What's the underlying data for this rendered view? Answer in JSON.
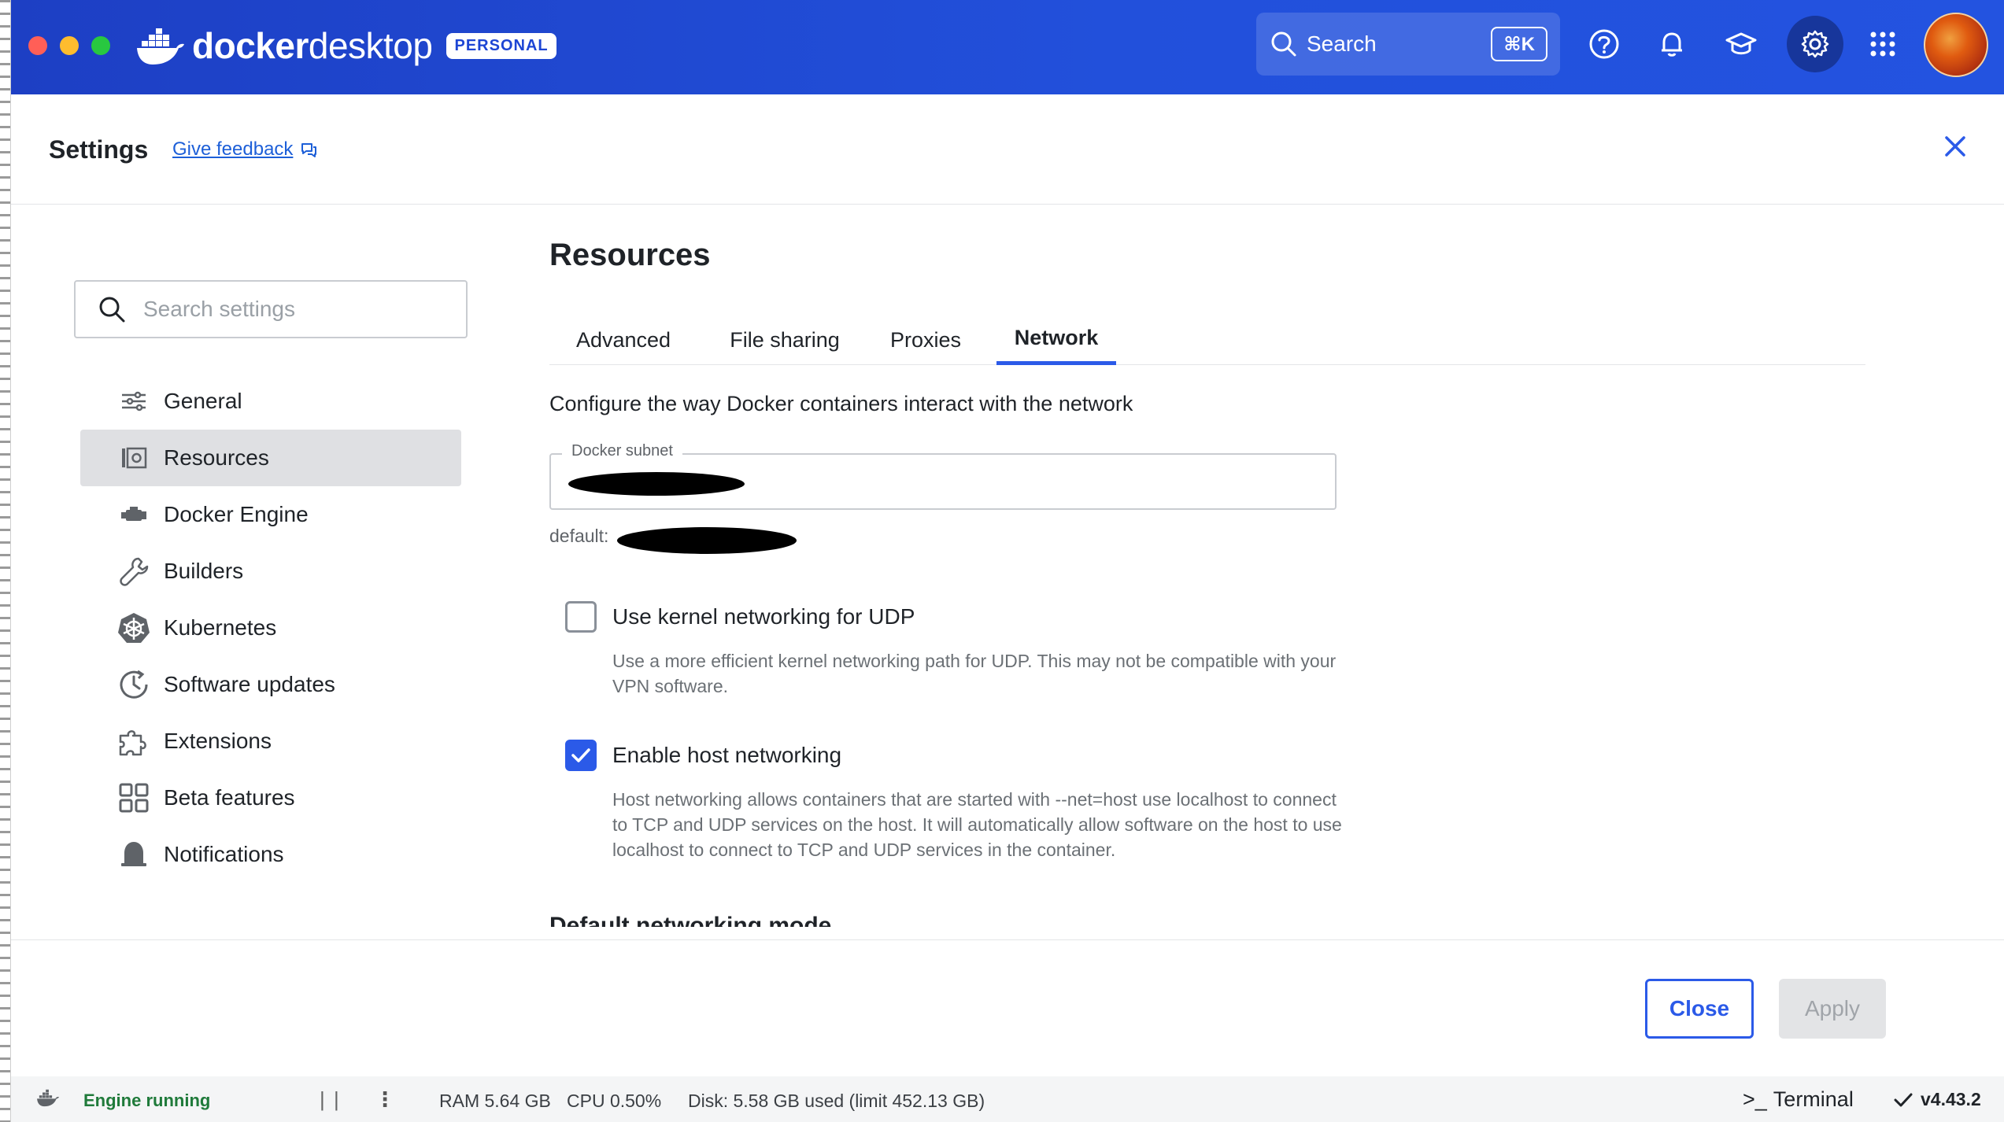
{
  "app": {
    "brand_text_bold": "docker",
    "brand_text": "desktop",
    "plan_badge": "PERSONAL"
  },
  "topbar": {
    "search_label": "Search",
    "search_shortcut": "⌘K",
    "icons": [
      "help-icon",
      "bell-icon",
      "learning-icon",
      "gear-icon",
      "apps-grid-icon",
      "avatar"
    ]
  },
  "settings": {
    "title": "Settings",
    "feedback_label": "Give feedback"
  },
  "sidebar": {
    "search_placeholder": "Search settings",
    "items": [
      {
        "label": "General",
        "icon": "sliders-icon"
      },
      {
        "label": "Resources",
        "icon": "resources-icon",
        "active": true
      },
      {
        "label": "Docker Engine",
        "icon": "engine-icon"
      },
      {
        "label": "Builders",
        "icon": "wrench-icon"
      },
      {
        "label": "Kubernetes",
        "icon": "kubernetes-icon"
      },
      {
        "label": "Software updates",
        "icon": "clock-update-icon"
      },
      {
        "label": "Extensions",
        "icon": "puzzle-icon"
      },
      {
        "label": "Beta features",
        "icon": "grid-icon"
      },
      {
        "label": "Notifications",
        "icon": "bell-icon"
      }
    ]
  },
  "main": {
    "title": "Resources",
    "tabs": [
      {
        "label": "Advanced"
      },
      {
        "label": "File sharing"
      },
      {
        "label": "Proxies"
      },
      {
        "label": "Network",
        "active": true
      }
    ],
    "intro": "Configure the way Docker containers interact with the network",
    "subnet": {
      "label": "Docker subnet",
      "default_prefix": "default:"
    },
    "options": [
      {
        "label": "Use kernel networking for UDP",
        "checked": false,
        "description": "Use a more efficient kernel networking path for UDP. This may not be compatible with your VPN software."
      },
      {
        "label": "Enable host networking",
        "checked": true,
        "description": "Host networking allows containers that are started with --net=host use localhost to connect to TCP and UDP services on the host. It will automatically allow software on the host to use localhost to connect to TCP and UDP services in the container."
      }
    ],
    "next_section_heading": "Default networking mode"
  },
  "footer": {
    "close_label": "Close",
    "apply_label": "Apply"
  },
  "statusbar": {
    "engine_status": "Engine running",
    "pause_symbol": "| |",
    "more_symbol": "⋮",
    "ram": "RAM 5.64 GB",
    "cpu": "CPU 0.50%",
    "disk": "Disk: 5.58 GB used (limit 452.13 GB)",
    "terminal_label": "Terminal",
    "terminal_prompt": ">_",
    "version": "v4.43.2"
  },
  "colors": {
    "titlebar": "#2250db",
    "accent": "#2b5ae8",
    "engine_running": "#1f7a3a"
  }
}
